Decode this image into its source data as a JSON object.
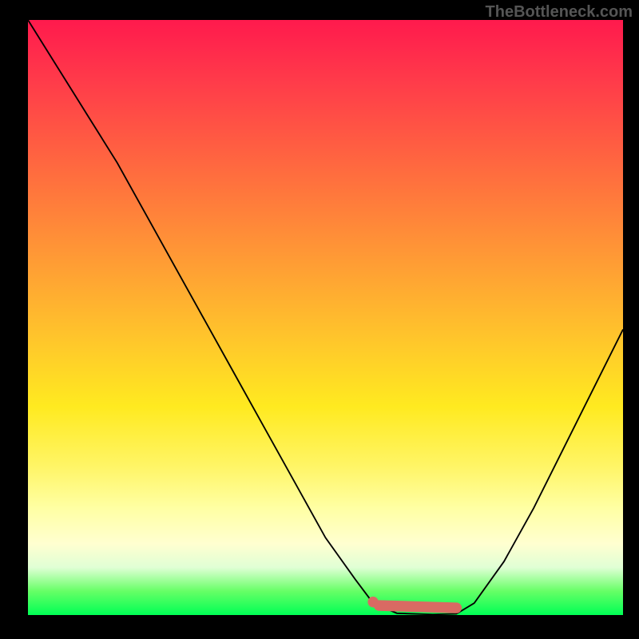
{
  "watermark": "TheBottleneck.com",
  "chart_data": {
    "type": "line",
    "title": "",
    "xlabel": "",
    "ylabel": "",
    "xlim": [
      0,
      100
    ],
    "ylim": [
      0,
      100
    ],
    "background_gradient": {
      "top": "#ff1a4d",
      "middle": "#ffea20",
      "bottom": "#00ff55"
    },
    "series": [
      {
        "name": "main-curve",
        "color": "#000000",
        "x": [
          0,
          5,
          10,
          15,
          20,
          25,
          30,
          35,
          40,
          45,
          50,
          55,
          58,
          62,
          68,
          72,
          75,
          80,
          85,
          90,
          95,
          100
        ],
        "values": [
          100,
          92,
          84,
          76,
          67,
          58,
          49,
          40,
          31,
          22,
          13,
          6,
          2,
          0.3,
          0.1,
          0.2,
          2,
          9,
          18,
          28,
          38,
          48
        ]
      }
    ],
    "markers": [
      {
        "name": "min-marker-start",
        "x": 58,
        "y": 2.2,
        "color": "#d96a63",
        "size": 9
      },
      {
        "name": "min-marker-dash",
        "type": "line",
        "x0": 59,
        "y0": 1.6,
        "x1": 72,
        "y1": 1.2,
        "color": "#d96a63",
        "width": 10
      }
    ]
  }
}
